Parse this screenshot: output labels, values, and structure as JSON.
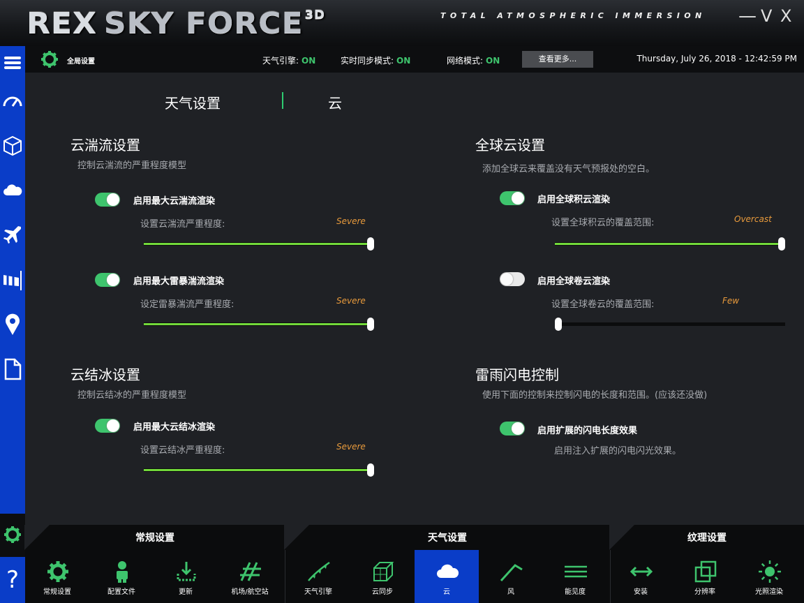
{
  "app": {
    "logo_main": "REX",
    "logo_rest": "SKY FORCE",
    "logo_sup": "3D",
    "tagline": "TOTAL ATMOSPHERIC IMMERSION",
    "win_minimize": "—",
    "win_restore": "V",
    "win_close": "X"
  },
  "statusbar": {
    "title": "全局设置",
    "weather_engine_label": "天气引擎:",
    "weather_engine_value": "ON",
    "realtime_sync_label": "实时同步模式:",
    "realtime_sync_value": "ON",
    "network_label": "网络模式:",
    "network_value": "ON",
    "more_button": "查看更多...",
    "datetime": "Thursday, July 26, 2018 - 12:42:59 PM"
  },
  "sidebar": {
    "items": [
      "menu-icon",
      "gauge-icon",
      "cube-icon",
      "cloud-icon",
      "airplane-icon",
      "windsock-icon",
      "map-pin-icon",
      "document-icon"
    ],
    "settings_icon": "gear-icon",
    "help": "?"
  },
  "tabs": {
    "weather_settings": "天气设置",
    "clouds": "云"
  },
  "turbulence": {
    "title": "云湍流设置",
    "subtitle": "控制云湍流的严重程度模型",
    "opt1_label": "启用最大云湍流渲染",
    "opt1_on": true,
    "opt1_slider_label": "设置云湍流严重程度:",
    "opt1_value": "Severe",
    "opt1_level": 1.0,
    "opt2_label": "启用最大雷暴湍流渲染",
    "opt2_on": true,
    "opt2_slider_label": "设定雷暴湍流严重程度:",
    "opt2_value": "Severe",
    "opt2_level": 1.0
  },
  "icing": {
    "title": "云结冰设置",
    "subtitle": "控制云结冰的严重程度模型",
    "opt1_label": "启用最大云结冰渲染",
    "opt1_on": true,
    "opt1_slider_label": "设置云结冰严重程度:",
    "opt1_value": "Severe",
    "opt1_level": 1.0
  },
  "global_clouds": {
    "title": "全球云设置",
    "subtitle": "添加全球云来覆盖没有天气预报处的空白。",
    "opt1_label": "启用全球积云渲染",
    "opt1_on": true,
    "opt1_slider_label": "设置全球积云的覆盖范围:",
    "opt1_value": "Overcast",
    "opt1_level": 1.0,
    "opt2_label": "启用全球卷云渲染",
    "opt2_on": false,
    "opt2_slider_label": "设置全球卷云的覆盖范围:",
    "opt2_value": "Few",
    "opt2_level": 0.0
  },
  "lightning": {
    "title": "雷雨闪电控制",
    "subtitle": "使用下面的控制来控制闪电的长度和范围。(应该还没做)",
    "opt1_label": "启用扩展的闪电长度效果",
    "opt1_on": true,
    "opt1_note": "启用注入扩展的闪电闪光效果。"
  },
  "bottom": {
    "categories": [
      "常规设置",
      "天气设置",
      "纹理设置"
    ],
    "buttons": [
      {
        "label": "常规设置",
        "icon": "gear-icon"
      },
      {
        "label": "配置文件",
        "icon": "user-icon"
      },
      {
        "label": "更新",
        "icon": "download-icon"
      },
      {
        "label": "机场/航空站",
        "icon": "runway-icon"
      },
      {
        "label": "天气引擎",
        "icon": "weather-engine-icon"
      },
      {
        "label": "云同步",
        "icon": "cloud-sync-cube-icon"
      },
      {
        "label": "云",
        "icon": "cloud-icon"
      },
      {
        "label": "风",
        "icon": "wind-icon"
      },
      {
        "label": "能见度",
        "icon": "visibility-icon"
      },
      {
        "label": "安装",
        "icon": "install-arrows-icon"
      },
      {
        "label": "分辨率",
        "icon": "resolution-icon"
      },
      {
        "label": "光照渲染",
        "icon": "sun-icon"
      }
    ],
    "active_index": 6
  },
  "colors": {
    "accent_green": "#3ec46d",
    "slider_green": "#72d93a",
    "sidebar_blue": "#0a3dc8",
    "value_orange": "#e89a3c"
  }
}
